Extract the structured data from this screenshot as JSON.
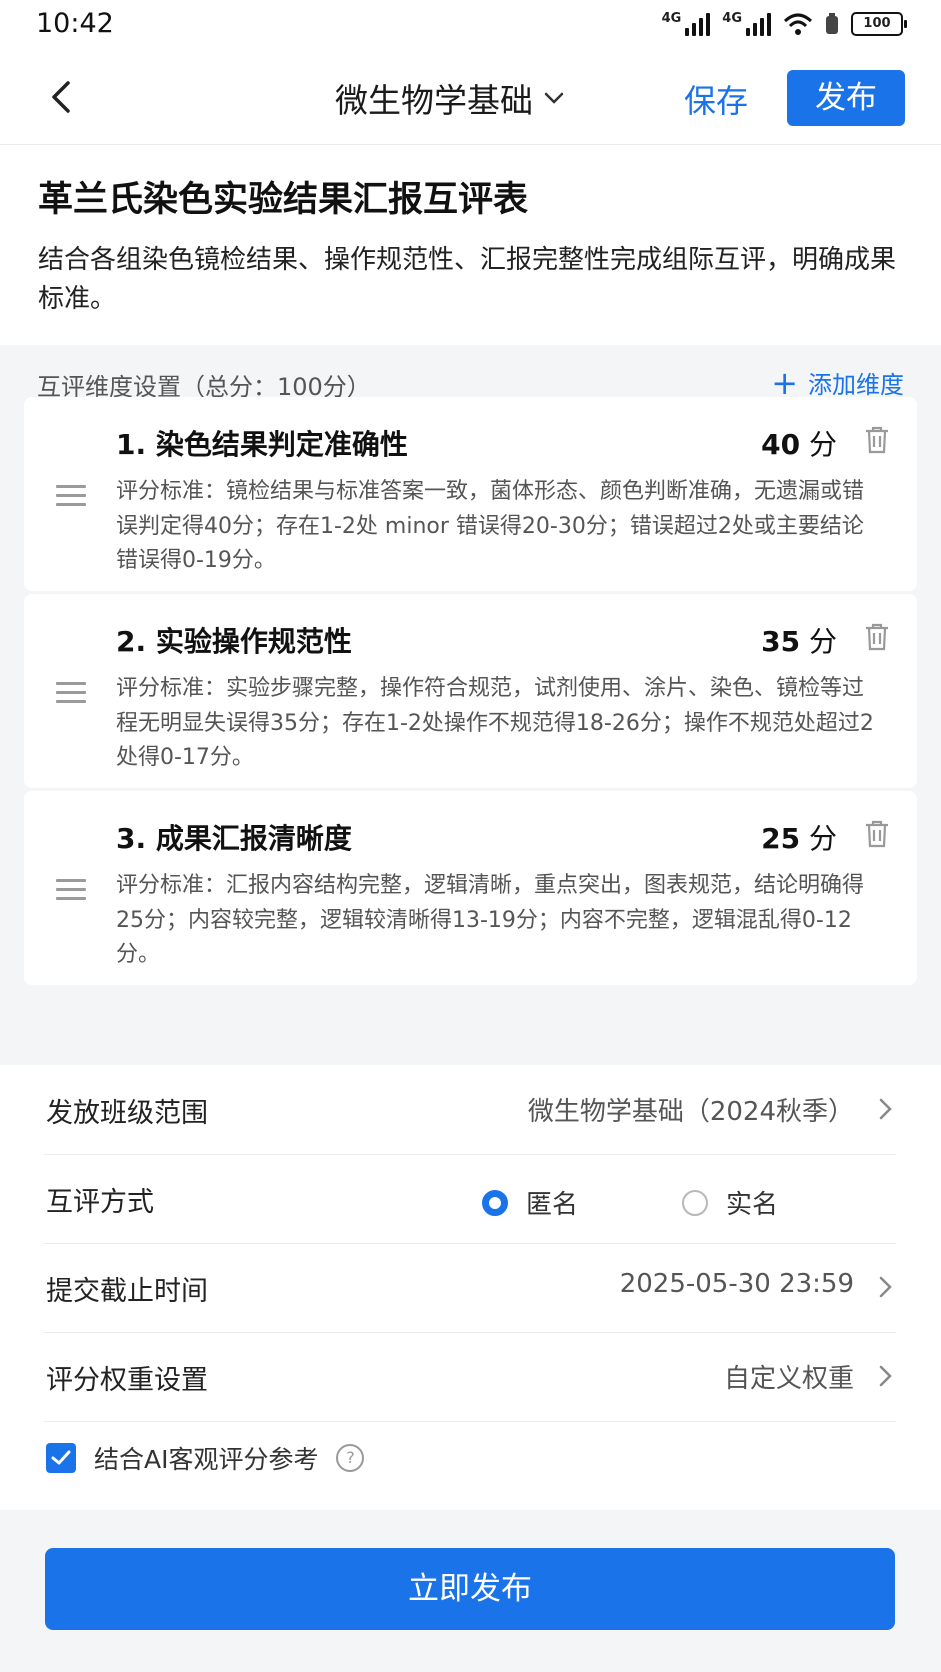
{
  "status_bar": {
    "time": "10:42",
    "signal_label_1": "4G",
    "signal_label_2": "4G",
    "battery": "100"
  },
  "nav": {
    "title": "微生物学基础",
    "save_label": "保存",
    "publish_label": "发布"
  },
  "form": {
    "title": "革兰氏染色实验结果汇报互评表",
    "description": "结合各组染色镜检结果、操作规范性、汇报完整性完成组际互评，明确成果标准。"
  },
  "dimensions": {
    "header": "互评维度设置（总分：100分）",
    "add_label": "添加维度",
    "unit": "分",
    "items": [
      {
        "title": "1. 染色结果判定准确性",
        "score": "40",
        "criteria": "评分标准：镜检结果与标准答案一致，菌体形态、颜色判断准确，无遗漏或错误判定得40分；存在1-2处 minor 错误得20-30分；错误超过2处或主要结论错误得0-19分。"
      },
      {
        "title": "2. 实验操作规范性",
        "score": "35",
        "criteria": "评分标准：实验步骤完整，操作符合规范，试剂使用、涂片、染色、镜检等过程无明显失误得35分；存在1-2处操作不规范得18-26分；操作不规范处超过2处得0-17分。"
      },
      {
        "title": "3. 成果汇报清晰度",
        "score": "25",
        "criteria": "评分标准：汇报内容结构完整，逻辑清晰，重点突出，图表规范，结论明确得25分；内容较完整，逻辑较清晰得13-19分；内容不完整，逻辑混乱得0-12分。"
      }
    ]
  },
  "settings": {
    "class_scope_label": "发放班级范围",
    "class_scope_value": "微生物学基础（2024秋季）",
    "review_mode_label": "互评方式",
    "review_mode_options": [
      "匿名",
      "实名"
    ],
    "review_mode_selected": "匿名",
    "deadline_label": "提交截止时间",
    "deadline_value": "2025-05-30 23:59",
    "weight_label": "评分权重设置",
    "weight_value": "自定义权重",
    "ai_reference_label": "结合AI客观评分参考",
    "ai_reference_checked": true
  },
  "bottom": {
    "publish_now_label": "立即发布"
  },
  "colors": {
    "accent": "#1a73e8",
    "background_grey": "#f4f5f7"
  },
  "icons": [
    "back-arrow-icon",
    "chevron-down-icon",
    "plus-icon",
    "drag-handle-icon",
    "trash-icon",
    "chevron-right-icon",
    "check-icon",
    "help-icon",
    "wifi-icon",
    "signal-icon",
    "battery-icon"
  ]
}
